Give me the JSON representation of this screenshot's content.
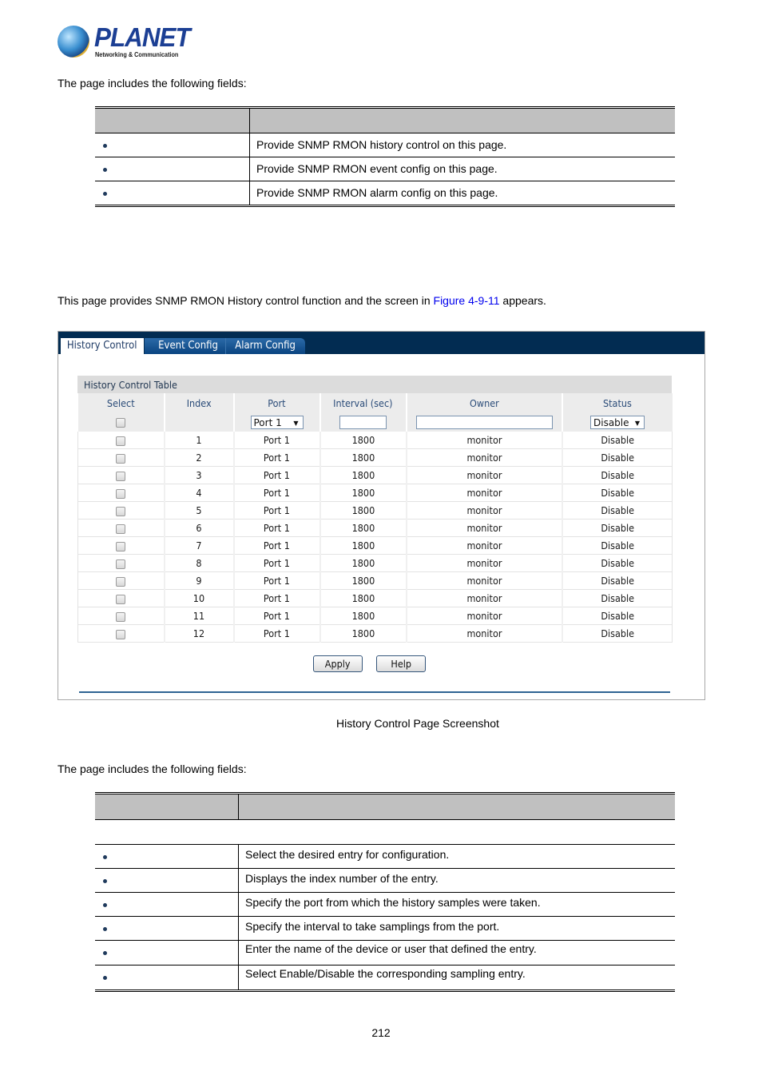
{
  "logo": {
    "brand": "PLANET",
    "tagline": "Networking & Communication"
  },
  "intro_text": "The page includes the following fields:",
  "menu_table": {
    "headers": [
      "",
      ""
    ],
    "rows": [
      {
        "object": "",
        "description": "Provide SNMP RMON history control on this page."
      },
      {
        "object": "",
        "description": "Provide SNMP RMON event config on this page."
      },
      {
        "object": "",
        "description": "Provide SNMP RMON alarm config on this page."
      }
    ]
  },
  "description": {
    "before": "This page provides SNMP RMON History control function and the screen in ",
    "link": "Figure 4-9-11",
    "after": " appears."
  },
  "screenshot": {
    "tabs": [
      {
        "label": "History Control",
        "active": true
      },
      {
        "label": "Event Config",
        "active": false
      },
      {
        "label": "Alarm Config",
        "active": false
      }
    ],
    "table_title": "History Control Table",
    "columns": [
      "Select",
      "Index",
      "Port",
      "Interval (sec)",
      "Owner",
      "Status"
    ],
    "filter": {
      "port_value": "Port 1",
      "interval_value": "",
      "owner_value": "",
      "status_value": "Disable"
    },
    "rows": [
      {
        "index": "1",
        "port": "Port 1",
        "interval": "1800",
        "owner": "monitor",
        "status": "Disable"
      },
      {
        "index": "2",
        "port": "Port 1",
        "interval": "1800",
        "owner": "monitor",
        "status": "Disable"
      },
      {
        "index": "3",
        "port": "Port 1",
        "interval": "1800",
        "owner": "monitor",
        "status": "Disable"
      },
      {
        "index": "4",
        "port": "Port 1",
        "interval": "1800",
        "owner": "monitor",
        "status": "Disable"
      },
      {
        "index": "5",
        "port": "Port 1",
        "interval": "1800",
        "owner": "monitor",
        "status": "Disable"
      },
      {
        "index": "6",
        "port": "Port 1",
        "interval": "1800",
        "owner": "monitor",
        "status": "Disable"
      },
      {
        "index": "7",
        "port": "Port 1",
        "interval": "1800",
        "owner": "monitor",
        "status": "Disable"
      },
      {
        "index": "8",
        "port": "Port 1",
        "interval": "1800",
        "owner": "monitor",
        "status": "Disable"
      },
      {
        "index": "9",
        "port": "Port 1",
        "interval": "1800",
        "owner": "monitor",
        "status": "Disable"
      },
      {
        "index": "10",
        "port": "Port 1",
        "interval": "1800",
        "owner": "monitor",
        "status": "Disable"
      },
      {
        "index": "11",
        "port": "Port 1",
        "interval": "1800",
        "owner": "monitor",
        "status": "Disable"
      },
      {
        "index": "12",
        "port": "Port 1",
        "interval": "1800",
        "owner": "monitor",
        "status": "Disable"
      }
    ],
    "buttons": {
      "apply": "Apply",
      "help": "Help"
    }
  },
  "caption": "History Control Page Screenshot",
  "fields_intro": "The page includes the following fields:",
  "fields_table": {
    "headers": [
      "",
      ""
    ],
    "rows": [
      {
        "object": "",
        "description": "Select the desired entry for configuration."
      },
      {
        "object": "",
        "description": "Displays the index number of the entry."
      },
      {
        "object": "",
        "description": "Specify the port from which the history samples were taken."
      },
      {
        "object": "",
        "description": "Specify the interval to take samplings from the port."
      },
      {
        "object": "",
        "description": "Enter the name of the device or user that defined the entry."
      },
      {
        "object": "",
        "description": "Select Enable/Disable the corresponding sampling entry."
      }
    ]
  },
  "page_number": "212"
}
